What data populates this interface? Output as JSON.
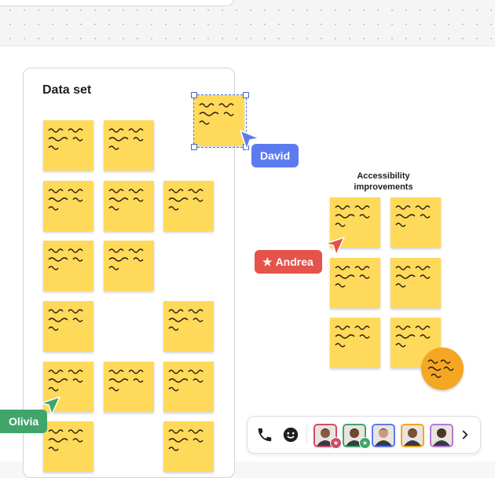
{
  "frame": {
    "title": "Data set"
  },
  "cluster": {
    "title_line1": "Accessibility",
    "title_line2": "improvements"
  },
  "cursors": {
    "david": {
      "name": "David",
      "color": "#5b7bef"
    },
    "andrea": {
      "name": "Andrea",
      "color": "#e5534b"
    },
    "olivia": {
      "name": "Olivia",
      "color": "#3fa56a"
    }
  },
  "colors": {
    "sticky_yellow": "#ffd95a",
    "sticky_orange": "#f5a623",
    "selection": "#3b63c9"
  },
  "toolbar": {
    "call_icon": "phone-icon",
    "reaction_icon": "emoji-icon",
    "more_icon": "chevron-right-icon",
    "avatars": [
      {
        "name": "avatar-1",
        "border": "#c94f68",
        "badge": "star"
      },
      {
        "name": "avatar-2",
        "border": "#3fa56a",
        "badge": "star"
      },
      {
        "name": "avatar-3",
        "border": "#5b7bef",
        "badge": ""
      },
      {
        "name": "avatar-4",
        "border": "#f5a623",
        "badge": ""
      },
      {
        "name": "avatar-5",
        "border": "#b57bd6",
        "badge": ""
      }
    ]
  }
}
